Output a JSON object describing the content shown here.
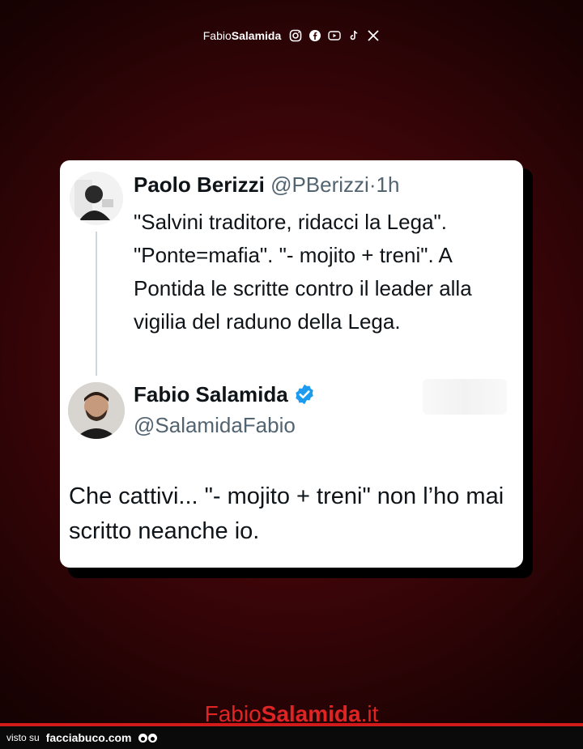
{
  "header": {
    "brand_light": "Fabio",
    "brand_bold": "Salamida",
    "social_icons": [
      "instagram-icon",
      "facebook-icon",
      "youtube-icon",
      "tiktok-icon",
      "x-icon"
    ]
  },
  "tweet1": {
    "author_name": "Paolo Berizzi",
    "handle": "@PBerizzi",
    "separator": "·",
    "time": "1h",
    "text": "\"Salvini traditore, ridacci la Lega\". \"Ponte=mafia\". \"- mojito + treni\". A Pontida le scritte contro il leader alla vigilia del raduno della Lega."
  },
  "tweet2": {
    "author_name": "Fabio Salamida",
    "handle": "@SalamidaFabio",
    "text": "Che cattivi... \"- mojito + treni\" non l’ho mai scritto neanche io."
  },
  "footer": {
    "brand_light": "Fabio",
    "brand_bold": "Salamida",
    "brand_tld": ".it",
    "visto_su": "visto su",
    "site": "facciabuco.com"
  },
  "colors": {
    "background": "#3a0508",
    "accent_red": "#e02424",
    "verified_blue": "#1d9bf0",
    "secondary_text": "#536471"
  }
}
